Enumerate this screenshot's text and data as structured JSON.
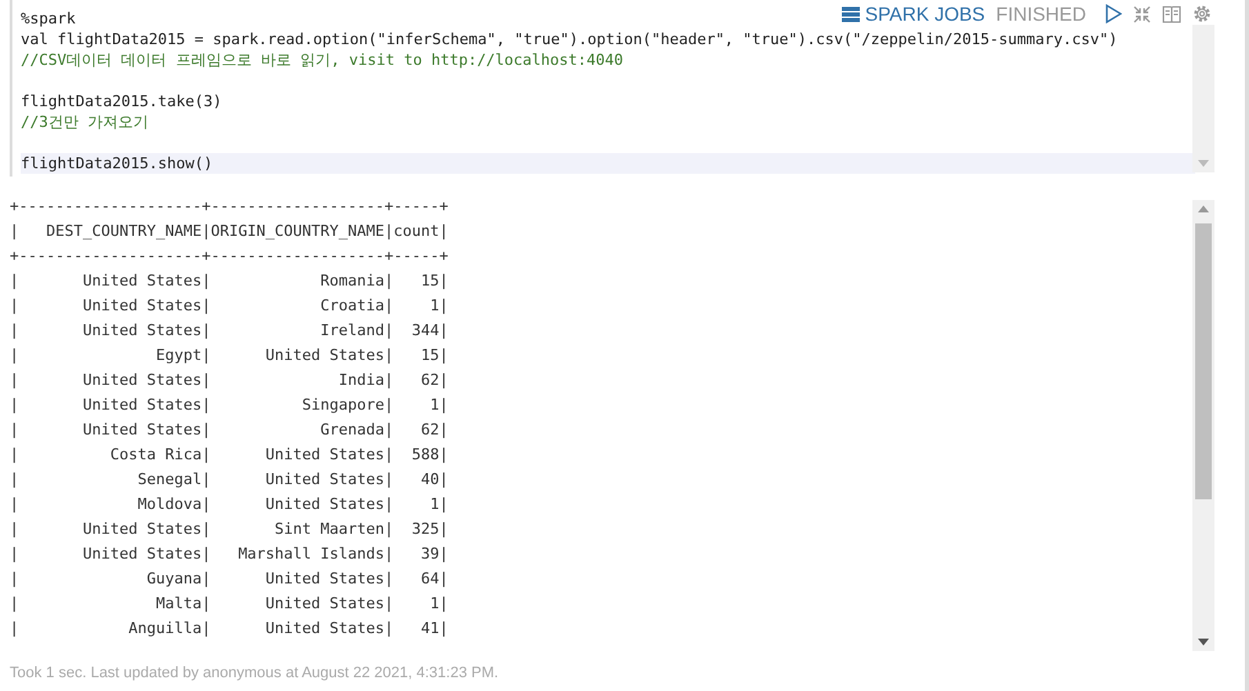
{
  "paragraph": {
    "status": "FINISHED",
    "spark_jobs": "SPARK JOBS",
    "code_lines": [
      {
        "kind": "code",
        "text": "%spark",
        "active": false
      },
      {
        "kind": "code",
        "text": "val flightData2015 = spark.read.option(\"inferSchema\", \"true\").option(\"header\", \"true\").csv(\"/zeppelin/2015-summary.csv\")",
        "active": false
      },
      {
        "kind": "comment",
        "text": "//CSV데이터 데이터 프레임으로 바로 읽기, visit to http://localhost:4040",
        "active": false
      },
      {
        "kind": "blank",
        "active": false
      },
      {
        "kind": "code",
        "text": "flightData2015.take(3)",
        "active": false
      },
      {
        "kind": "comment",
        "text": "//3건만 가져오기",
        "active": false
      },
      {
        "kind": "blank",
        "active": false
      },
      {
        "kind": "code",
        "text": "flightData2015.show()",
        "active": true
      }
    ],
    "output_lines": [
      "+--------------------+-------------------+-----+",
      "|   DEST_COUNTRY_NAME|ORIGIN_COUNTRY_NAME|count|",
      "+--------------------+-------------------+-----+",
      "|       United States|            Romania|   15|",
      "|       United States|            Croatia|    1|",
      "|       United States|            Ireland|  344|",
      "|               Egypt|      United States|   15|",
      "|       United States|              India|   62|",
      "|       United States|          Singapore|    1|",
      "|       United States|            Grenada|   62|",
      "|          Costa Rica|      United States|  588|",
      "|             Senegal|      United States|   40|",
      "|             Moldova|      United States|    1|",
      "|       United States|       Sint Maarten|  325|",
      "|       United States|   Marshall Islands|   39|",
      "|              Guyana|      United States|   64|",
      "|               Malta|      United States|    1|",
      "|            Anguilla|      United States|   41|"
    ],
    "footer": "Took 1 sec. Last updated by anonymous at August 22 2021, 4:31:23 PM."
  }
}
